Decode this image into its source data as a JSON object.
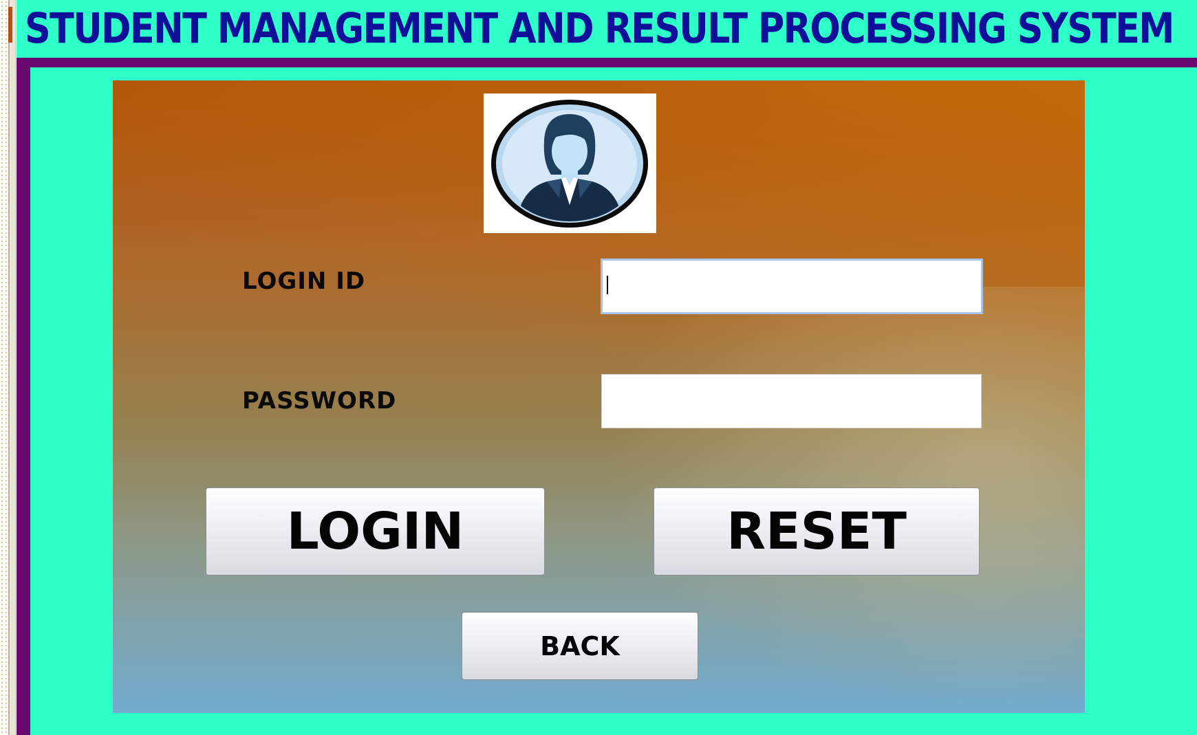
{
  "app": {
    "title": "STUDENT MANAGEMENT AND RESULT PROCESSING SYSTEM"
  },
  "colors": {
    "background": "#2effc8",
    "title_text": "#0f0f9a",
    "frame_border": "#6a0a6e"
  },
  "login": {
    "avatar_icon": "female-user-avatar-icon",
    "login_id_label": "LOGIN ID",
    "login_id_value": "",
    "password_label": "PASSWORD",
    "password_value": "",
    "login_button": "LOGIN",
    "reset_button": "RESET",
    "back_button": "BACK"
  }
}
